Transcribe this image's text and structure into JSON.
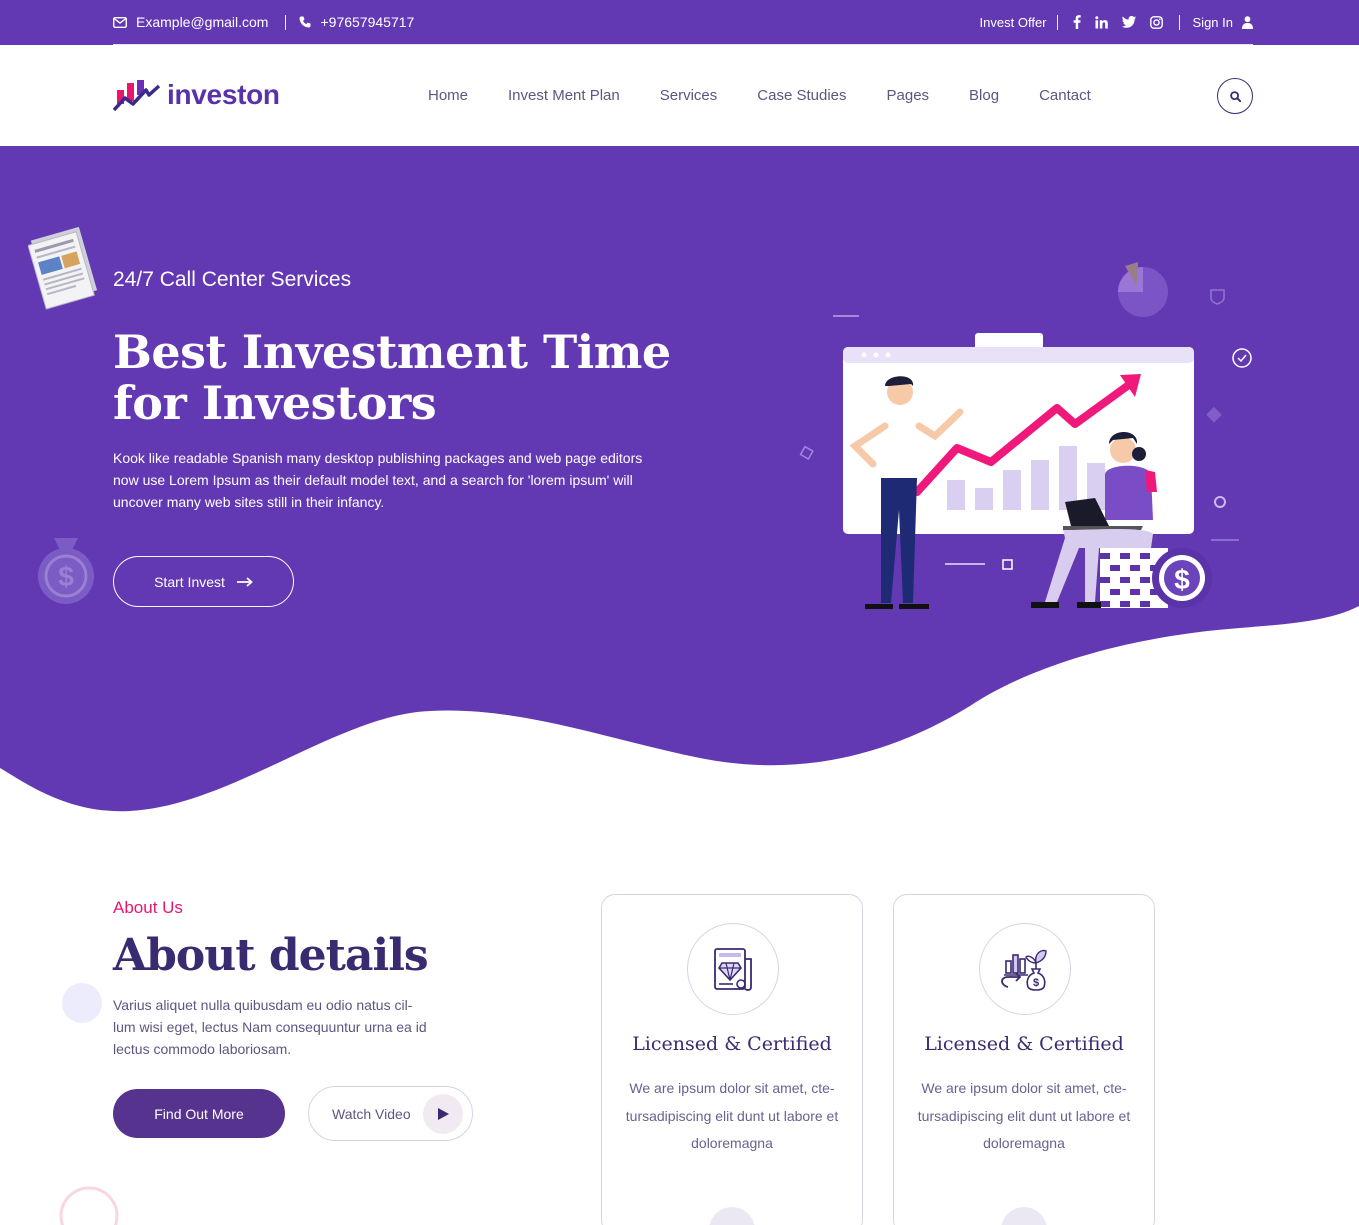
{
  "colors": {
    "primary": "#6339b3",
    "accent": "#e8166e",
    "dark": "#3a2a70"
  },
  "topbar": {
    "email": "Example@gmail.com",
    "phone": "+97657945717",
    "invest_offer": "Invest Offer",
    "signin": "Sign In",
    "icons": [
      "envelope-icon",
      "phone-icon",
      "facebook-icon",
      "linkedin-icon",
      "twitter-icon",
      "instagram-icon",
      "user-icon"
    ]
  },
  "header": {
    "logo_text": "investon",
    "nav": [
      "Home",
      "Invest Ment Plan",
      "Services",
      "Case Studies",
      "Pages",
      "Blog",
      "Cantact"
    ],
    "search_icon": "search-icon"
  },
  "hero": {
    "subtitle": "24/7 Call Center Services",
    "title": "Best Investment Time for Investors",
    "text": "Kook like readable Spanish many desktop publishing packages and web page editors now use Lorem Ipsum as their default model text, and a search for 'lorem ipsum' will uncover many web sites still in their infancy.",
    "button": "Start Invest"
  },
  "about": {
    "tag": "About Us",
    "title": "About details",
    "text": "Varius aliquet nulla quibusdam eu odio natus cil-lum wisi eget, lectus Nam consequuntur urna ea id lectus commodo laboriosam.",
    "find_button": "Find Out More",
    "watch_button": "Watch Video"
  },
  "cards": [
    {
      "title": "Licensed & Certified",
      "text": "We are ipsum dolor sit amet, cte-tursadipiscing elit dunt ut labore et doloremagna",
      "icon": "certificate-diamond-icon"
    },
    {
      "title": "Licensed & Certified",
      "text": "We are ipsum dolor sit amet, cte-tursadipiscing elit dunt ut labore et doloremagna",
      "icon": "investment-growth-icon"
    }
  ]
}
